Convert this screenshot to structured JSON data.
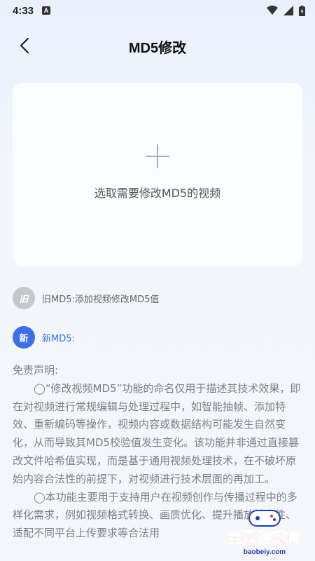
{
  "status_bar": {
    "time": "4:33",
    "notification_glyph": "A",
    "icons": [
      "wifi-icon",
      "cell-signal-icon",
      "battery-icon"
    ]
  },
  "header": {
    "title": "MD5修改",
    "back_icon": "chevron-left-icon"
  },
  "upload": {
    "icon": "plus-icon",
    "label": "选取需要修改MD5的视频"
  },
  "old_md5": {
    "badge": "旧",
    "label": "旧MD5:添加视频修改MD5值"
  },
  "new_md5": {
    "badge": "新",
    "label": "新MD5:"
  },
  "disclaimer": {
    "title": "免责声明:",
    "paragraphs": [
      "◯“修改视频MD5”功能的命名仅用于描述其技术效果，即在对视频进行常规编辑与处理过程中，如智能抽帧、添加特效、重新编码等操作，视频内容或数据结构可能发生自然变化，从而导致其MD5校验值发生变化。该功能并非通过直接篡改文件哈希值实现，而是基于通用视频处理技术，在不破坏原始内容合法性的前提下，对视频进行技术层面的再加工。",
      "◯本功能主要用于支持用户在视频创作与传播过程中的多样化需求，例如视频格式转换、画质优化、提升播放兼容性、适配不同平台上传要求等合法用"
    ]
  },
  "watermark": {
    "brand": "宝贝游戏网",
    "url": "baobeiy.com"
  },
  "colors": {
    "accent": "#3d6ee8",
    "old_badge": "#c5c7cc",
    "watermark_orange": "#f08a1c"
  }
}
